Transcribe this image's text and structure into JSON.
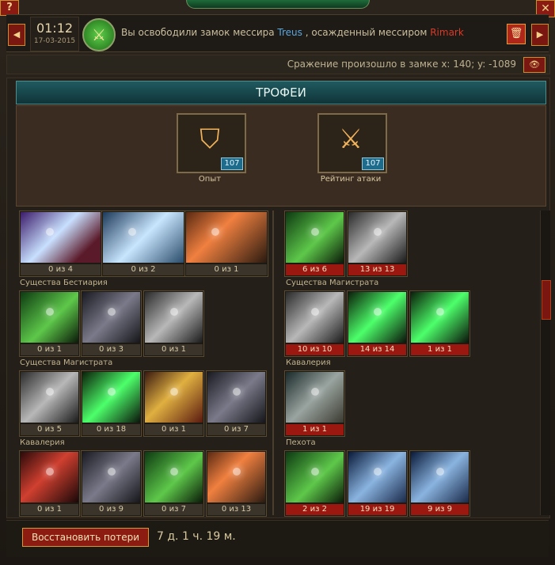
{
  "window": {
    "help_label": "?",
    "close_label": "✕"
  },
  "message": {
    "time": "01:12",
    "date": "17-03-2015",
    "icon": "crossed-swords-icon",
    "text_before": "Вы освободили замок мессира",
    "ally": "Treus",
    "text_middle": ", осажденный мессиром",
    "enemy": "Rimark",
    "prev_label": "◀",
    "next_label": "▶",
    "delete_icon": "trash-icon",
    "delete_label": "🗑"
  },
  "location": {
    "text": "Сражение произошло в замке x: 140; y: -1089",
    "eye_icon": "eye-icon",
    "eye_label": "👁"
  },
  "trophies": {
    "title": "ТРОФЕИ",
    "items": [
      {
        "label": "Опыт",
        "value": "107",
        "icon": "shield-emblem-icon",
        "glyph": "⛉"
      },
      {
        "label": "Рейтинг атаки",
        "value": "107",
        "icon": "crossed-swords-icon",
        "glyph": "⚔"
      }
    ]
  },
  "left": {
    "row1": [
      "0 из 4",
      "0 из 2",
      "0 из 1"
    ],
    "group1": "Существа Бестиария",
    "row2": [
      "0 из 1",
      "0 из 3",
      "0 из 1"
    ],
    "group2": "Существа Магистрата",
    "row3": [
      "0 из 5",
      "0 из 18",
      "0 из 1",
      "0 из 7"
    ],
    "group3": "Кавалерия",
    "row4": [
      "0 из 1",
      "0 из 9",
      "0 из 7",
      "0 из 13"
    ]
  },
  "right": {
    "row1": [
      "6 из 6",
      "13 из 13"
    ],
    "group1": "Существа Магистрата",
    "row2": [
      "10 из 10",
      "14 из 14",
      "1 из 1"
    ],
    "group2": "Кавалерия",
    "row3": [
      "1 из 1"
    ],
    "group3": "Пехота",
    "row4": [
      "2 из 2",
      "19 из 19",
      "9 из 9"
    ]
  },
  "footer": {
    "restore_label": "Восстановить потери",
    "timer": "7 д. 1 ч. 19 м."
  }
}
